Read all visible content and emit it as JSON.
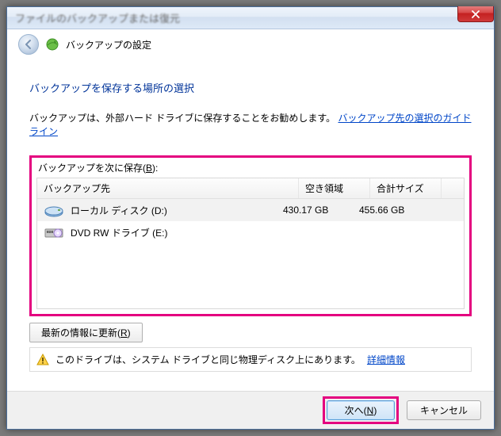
{
  "titlebar": {
    "blurred_text": "ファイルのバックアップまたは復元",
    "close_label": "×"
  },
  "header": {
    "title": "バックアップの設定"
  },
  "page": {
    "subtitle": "バックアップを保存する場所の選択",
    "help_prefix": "バックアップは、外部ハード ドライブに保存することをお勧めします。",
    "help_link": "バックアップ先の選択のガイドライン",
    "list_label_prefix": "バックアップを次に保存(",
    "list_label_key": "B",
    "list_label_suffix": "):"
  },
  "columns": {
    "dest": "バックアップ先",
    "free": "空き領域",
    "total": "合計サイズ"
  },
  "drives": [
    {
      "icon": "hdd",
      "name": "ローカル ディスク (D:)",
      "free": "430.17 GB",
      "total": "455.66 GB",
      "selected": true
    },
    {
      "icon": "dvd",
      "name": "DVD RW ドライブ (E:)",
      "free": "",
      "total": "",
      "selected": false
    }
  ],
  "refresh": {
    "label_prefix": "最新の情報に更新(",
    "label_key": "R",
    "label_suffix": ")"
  },
  "info": {
    "text": "このドライブは、システム ドライブと同じ物理ディスク上にあります。",
    "link": "詳細情報"
  },
  "footer": {
    "next_prefix": "次へ(",
    "next_key": "N",
    "next_suffix": ")",
    "cancel": "キャンセル"
  }
}
